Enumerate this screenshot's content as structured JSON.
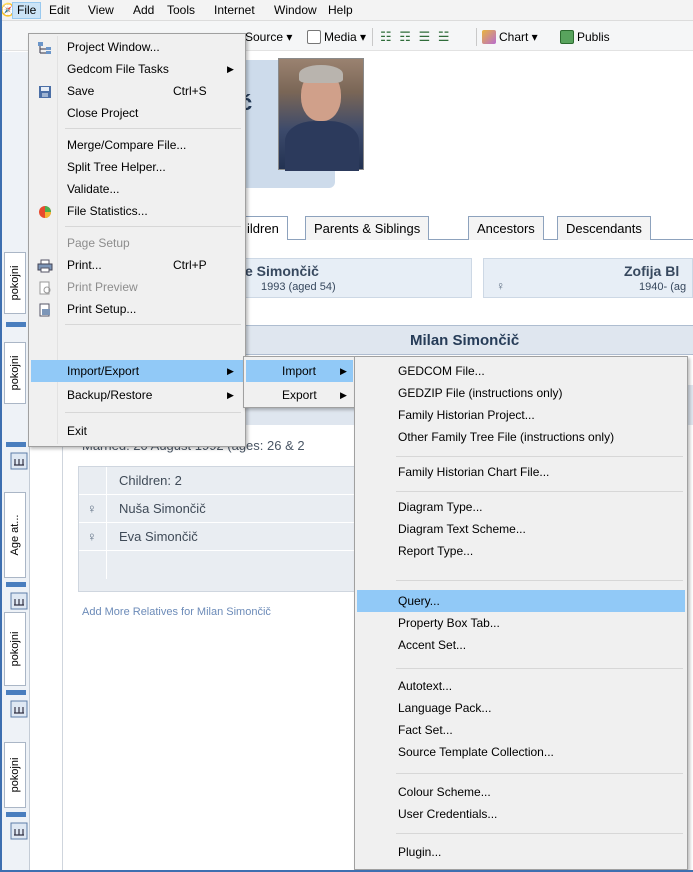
{
  "menubar": {
    "items": [
      "File",
      "Edit",
      "View",
      "Add",
      "Tools",
      "Internet",
      "Window",
      "Help"
    ],
    "active": "File"
  },
  "toolbar": {
    "source_label": "Source ▾",
    "media_label": "Media ▾",
    "chart_label": "Chart ▾",
    "publish_label": "Publis"
  },
  "left_tabs": [
    "pokojni",
    "pokojni",
    "Age at...",
    "pokojni",
    "pokojni"
  ],
  "person": {
    "name_fragment": "ć"
  },
  "tabs": [
    "ildren",
    "Parents & Siblings",
    "Ancestors",
    "Descendants"
  ],
  "parents": {
    "father_name": "e Simončič",
    "father_dates": "1993 (aged 54)",
    "mother_name": "Zofija Bl",
    "mother_dates": "1940- (ag"
  },
  "focus": {
    "name": "Milan Simončič"
  },
  "family": {
    "married": "Married: 20 August 1992 (ages: 26 & 2",
    "children_header": "Children: 2",
    "children": [
      "Nuša Simončič",
      "Eva Simončič"
    ],
    "add_more": "Add More Relatives for Milan Simončič"
  },
  "file_menu": {
    "project_window": "Project Window...",
    "gedcom_tasks": "Gedcom File Tasks",
    "save": "Save",
    "save_shortcut": "Ctrl+S",
    "close_project": "Close Project",
    "merge_compare": "Merge/Compare File...",
    "split_tree": "Split Tree Helper...",
    "validate": "Validate...",
    "file_statistics": "File Statistics...",
    "page_setup": "Page Setup",
    "print": "Print...",
    "print_shortcut": "Ctrl+P",
    "print_preview": "Print Preview",
    "print_setup": "Print Setup...",
    "import_export": "Import/Export",
    "backup_restore": "Backup/Restore",
    "exit": "Exit"
  },
  "import_export_menu": {
    "import": "Import",
    "export": "Export"
  },
  "import_menu": {
    "items": [
      "GEDCOM File...",
      "GEDZIP File (instructions only)",
      "Family Historian Project...",
      "Other Family Tree File (instructions only)",
      "Family Historian Chart File...",
      "Diagram Type...",
      "Diagram Text Scheme...",
      "Report Type...",
      "Query...",
      "Property Box Tab...",
      "Accent Set...",
      "Autotext...",
      "Language Pack...",
      "Fact Set...",
      "Source Template Collection...",
      "Colour Scheme...",
      "User Credentials...",
      "Plugin..."
    ],
    "highlighted": "Query..."
  },
  "colors": {
    "menu_highlight": "#91c9f7",
    "menu_bg": "#f0f0f0",
    "accent_blue": "#3d6fb0",
    "card_bg": "#e7eef6"
  }
}
